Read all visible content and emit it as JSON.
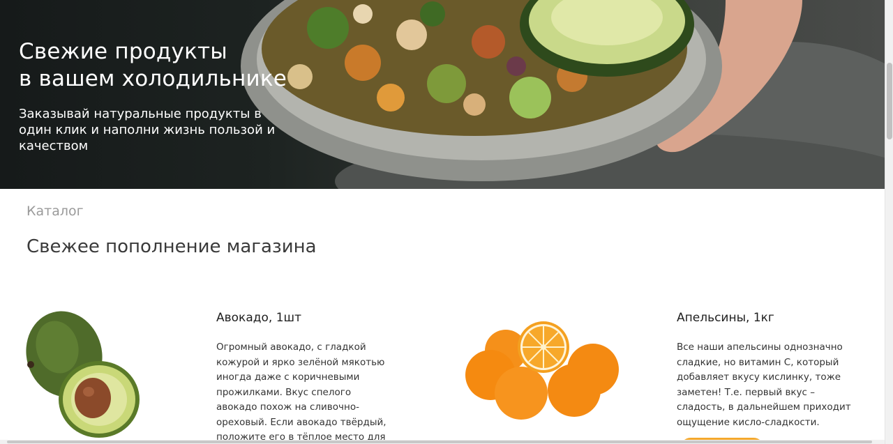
{
  "hero": {
    "title_line1": "Свежие продукты",
    "title_line2": "в вашем холодильнике",
    "subtitle": "Заказывай натуральные продукты в один клик и наполни жизнь пользой и качеством"
  },
  "catalog": {
    "label": "Каталог",
    "title": "Свежее пополнение магазина",
    "products": [
      {
        "name": "Авокадо, 1шт",
        "description": "Огромный авокадо, с гладкой кожурой и ярко зелёной мякотью иногда даже с коричневыми прожилками. Вкус спелого авокадо похож на сливочно-ореховый. Если авокадо твёрдый, положите его в тёплое место для"
      },
      {
        "name": "Апельсины, 1кг",
        "description": "Все наши апельсины однозначно сладкие, но витамин С, который добавляет вкусу кислинку, тоже заметен! Т.е. первый вкус – сладость, в дальнейшем приходит ощущение кисло-сладкости."
      }
    ]
  },
  "colors": {
    "accent": "#f4a82c",
    "hero_text": "#ffffff",
    "label_gray": "#9a9a9a"
  }
}
